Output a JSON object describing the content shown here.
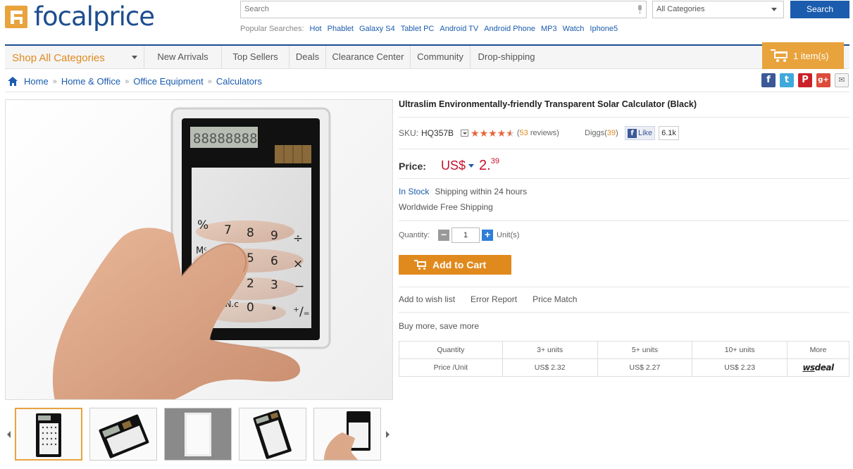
{
  "header": {
    "logo_text": "focalprice",
    "search_placeholder": "Search",
    "category_select": "All Categories",
    "search_button": "Search",
    "popular_label": "Popular Searches:",
    "popular": [
      "Hot",
      "Phablet",
      "Galaxy S4",
      "Tablet PC",
      "Android TV",
      "Android Phone",
      "MP3",
      "Watch",
      "Iphone5"
    ]
  },
  "nav": {
    "shop_all": "Shop All Categories",
    "items": [
      "New Arrivals",
      "Top Sellers",
      "Deals",
      "Clearance Center",
      "Community",
      "Drop-shipping"
    ],
    "cart_label": "1 item(s)"
  },
  "breadcrumb": {
    "items": [
      "Home",
      "Home & Office",
      "Office Equipment",
      "Calculators"
    ],
    "separator": "»"
  },
  "share": {
    "icons": [
      "facebook-icon",
      "twitter-icon",
      "pinterest-icon",
      "google-plus-icon",
      "email-icon"
    ]
  },
  "product": {
    "title": "Ultraslim Environmentally-friendly Transparent Solar Calculator (Black)",
    "sku_label": "SKU:",
    "sku": "HQ357B",
    "rating": 4.5,
    "reviews_count": "53",
    "reviews_suffix": "reviews",
    "diggs_label": "Diggs",
    "diggs_count": "39",
    "fb_like": "Like",
    "fb_count": "6.1k",
    "price_label": "Price:",
    "currency": "US$",
    "price_int": "2.",
    "price_dec": "39",
    "stock": "In Stock",
    "shipping": "Shipping within 24 hours",
    "worldwide": "Worldwide Free Shipping",
    "qty_label": "Quantity:",
    "qty_value": "1",
    "qty_unit": "Unit(s)",
    "add_to_cart": "Add to Cart",
    "actions": [
      "Add to wish list",
      "Error Report",
      "Price Match"
    ],
    "buy_more": "Buy more, save more"
  },
  "tiers": {
    "header": [
      "Quantity",
      "3+ units",
      "5+ units",
      "10+ units",
      "More"
    ],
    "row_label": "Price /Unit",
    "prices": [
      "US$ 2.32",
      "US$ 2.27",
      "US$ 2.23"
    ],
    "more_logo_a": "ws",
    "more_logo_b": "deal"
  },
  "colors": {
    "brand_blue": "#1d4d8f",
    "accent_orange": "#e8a33d",
    "price_red": "#c8102e"
  }
}
